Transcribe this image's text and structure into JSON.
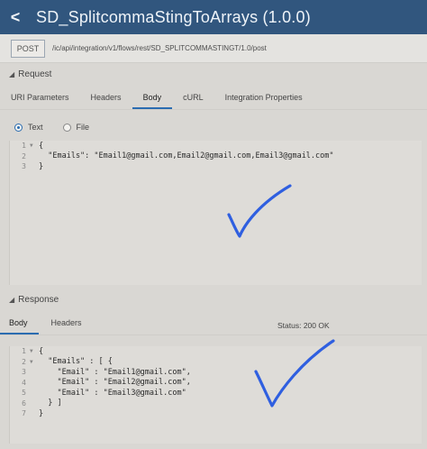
{
  "header": {
    "back_label": "<",
    "title": "SD_SplitcommaStingToArrays (1.0.0)"
  },
  "request_line": {
    "method": "POST",
    "url": "/ic/api/integration/v1/flows/rest/SD_SPLITCOMMASTINGT/1.0/post"
  },
  "request": {
    "section_label": "Request",
    "tabs": [
      {
        "label": "URI Parameters",
        "active": false
      },
      {
        "label": "Headers",
        "active": false
      },
      {
        "label": "Body",
        "active": true
      },
      {
        "label": "cURL",
        "active": false
      },
      {
        "label": "Integration Properties",
        "active": false
      }
    ],
    "body_type": {
      "options": [
        {
          "label": "Text",
          "selected": true
        },
        {
          "label": "File",
          "selected": false
        }
      ]
    },
    "body_lines": [
      {
        "num": "1",
        "text": "{"
      },
      {
        "num": "2",
        "text": "  \"Emails\": \"Email1@gmail.com,Email2@gmail.com,Email3@gmail.com\""
      },
      {
        "num": "3",
        "text": "}"
      }
    ]
  },
  "response": {
    "section_label": "Response",
    "tabs": [
      {
        "label": "Body",
        "active": true
      },
      {
        "label": "Headers",
        "active": false
      }
    ],
    "status": "Status: 200 OK",
    "body_lines": [
      {
        "num": "1",
        "text": "{"
      },
      {
        "num": "2",
        "text": "  \"Emails\" : [ {"
      },
      {
        "num": "3",
        "text": "    \"Email\" : \"Email1@gmail.com\","
      },
      {
        "num": "4",
        "text": "    \"Email\" : \"Email2@gmail.com\","
      },
      {
        "num": "5",
        "text": "    \"Email\" : \"Email3@gmail.com\""
      },
      {
        "num": "6",
        "text": "  } ]"
      },
      {
        "num": "7",
        "text": "}"
      }
    ]
  },
  "colors": {
    "titlebar": "#31567e",
    "accent": "#2b6cb0",
    "checkmark": "#2f5fe0"
  }
}
